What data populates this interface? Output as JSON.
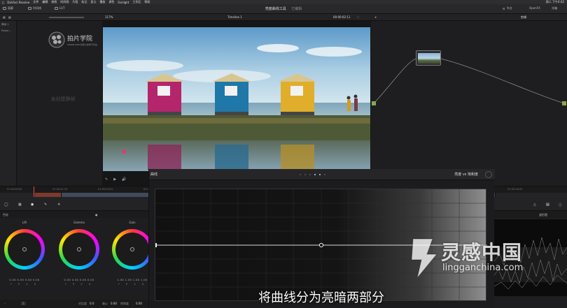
{
  "menubar": {
    "app": "DaVinci Resolve",
    "items": [
      "文件",
      "编辑",
      "修剪",
      "时间线",
      "片段",
      "标记",
      "显示",
      "播放",
      "调色",
      "Fairlight",
      "工作区",
      "帮助"
    ],
    "clock": "周二 下午4:42"
  },
  "header": {
    "gallery_label": "画廊",
    "lut_label": "时间线",
    "clips_label": "LUT",
    "title": "亮度曲线工具",
    "subtitle": "已编辑",
    "nodes_label": "节点",
    "openfx_label": "OpenFX",
    "lightbox_label": "光箱"
  },
  "toolbar2": {
    "zoom": "117%",
    "timeline_name": "Timeline 1",
    "timecode": "00:00:02:11",
    "clip_label": "剪辑"
  },
  "gallery": {
    "tree_items": [
      "静帧 1",
      "Power..."
    ],
    "empty_text": "未创建静帧",
    "logo_cn": "拍片学院",
    "logo_en": "XIPIAN.COM 影视人的学习平台"
  },
  "timeline": {
    "ticks": [
      "01:00:00:00",
      "01:00:01:15",
      "01:00:03:01",
      "01:00:04:16",
      "01:00:06:02",
      "01:00:07:17",
      "01:00:09:03",
      "01:00:10:18",
      "01:00:12:04",
      "01:00:13:19",
      "01:00:15:05",
      "01:00:16:20"
    ]
  },
  "wheels": {
    "section_label": "色轮",
    "wheels": [
      {
        "name": "Lift",
        "values": "0.00  0.00  0.00  0.00",
        "rgb": "Y R G B"
      },
      {
        "name": "Gamma",
        "values": "0.00  0.00  0.00  0.00",
        "rgb": "Y R G B"
      },
      {
        "name": "Gain",
        "values": "1.00  1.00  1.00  1.00",
        "rgb": "Y R G B"
      }
    ],
    "bottom_contrast_label": "对比度",
    "bottom_contrast_value": "0.0",
    "bottom_pivot_label": "轴心",
    "bottom_pivot_value": "0.00",
    "bottom_sat_label": "饱和度",
    "bottom_sat_value": "0.00",
    "page_num": "1"
  },
  "curves": {
    "title": "曲线",
    "mode": "亮度 vs 饱和度",
    "subtitle_text": "将曲线分为亮暗两部分"
  },
  "scopes": {
    "title": "波形图"
  },
  "watermark": {
    "cn": "灵感中国",
    "en": "lingganchina.com"
  }
}
